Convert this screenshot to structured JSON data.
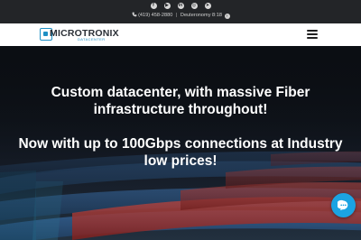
{
  "topbar": {
    "social_icons": [
      {
        "name": "facebook-icon",
        "glyph": "f"
      },
      {
        "name": "youtube-icon",
        "glyph": "▶"
      },
      {
        "name": "linkedin-icon",
        "glyph": "in"
      },
      {
        "name": "instagram-icon",
        "glyph": "◎"
      },
      {
        "name": "telegram-icon",
        "glyph": "➤"
      }
    ],
    "phone": "(419) 458-2880",
    "address": "Deuteronomy 8:18",
    "icon_names": {
      "phone": "phone-icon",
      "arrow": "arrow-right-icon"
    }
  },
  "navbar": {
    "logo_text": "MICROTRONIX",
    "logo_sub": "DATACENTER",
    "menu_icon": "hamburger-menu-icon"
  },
  "hero": {
    "line1": "Custom datacenter, with massive Fiber",
    "line2": "infrastructure throughout!",
    "line3": "Now with up to 100Gbps connections at Industry",
    "line4": "low prices!"
  },
  "chat": {
    "icon": "chat-icon"
  },
  "colors": {
    "topbar_bg": "#232528",
    "accent": "#1d8fc4",
    "chat_bg": "#1ba3e2",
    "hero_text": "#ffffff"
  }
}
